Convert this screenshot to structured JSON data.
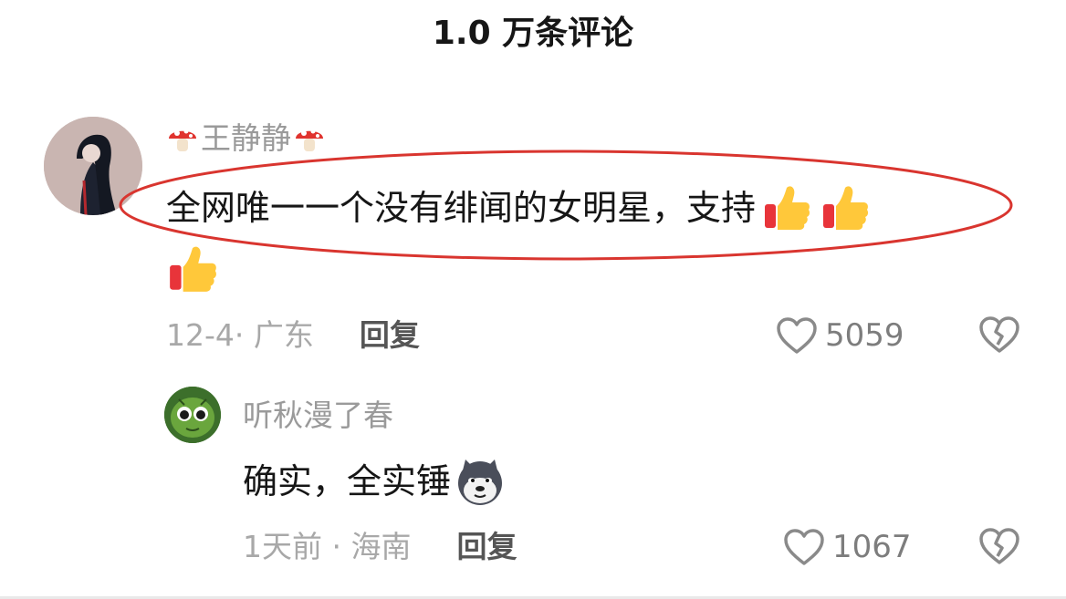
{
  "header": {
    "title": "1.0 万条评论"
  },
  "comments": [
    {
      "username": "王静静",
      "text": "全网唯一一个没有绯闻的女明星，支持",
      "meta": "12-4· 广东",
      "reply_label": "回复",
      "likes": "5059"
    },
    {
      "username": "听秋漫了春",
      "text": "确实，全实锤",
      "meta": "1天前 · 海南",
      "reply_label": "回复",
      "likes": "1067"
    }
  ],
  "colors": {
    "highlight": "#d9352f",
    "text_primary": "#161616",
    "text_secondary": "#a8a8a8"
  },
  "icons": [
    "mushroom-icon",
    "thumbs-up-icon",
    "doge-icon",
    "heart-outline-icon",
    "broken-heart-icon"
  ]
}
